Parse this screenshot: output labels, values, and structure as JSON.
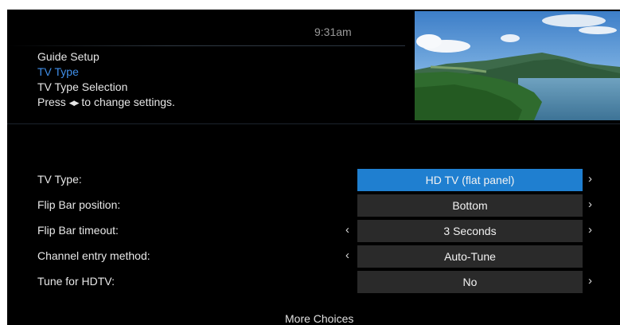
{
  "status": {
    "time": "9:31am"
  },
  "breadcrumb": {
    "items": [
      "Guide Setup",
      "TV Type",
      "TV Type Selection"
    ],
    "active_index": 1,
    "hint_prefix": "Press",
    "hint_arrows": "◀▶",
    "hint_suffix": "to change settings."
  },
  "preview": {
    "icon": "live-tv-preview-landscape"
  },
  "settings": [
    {
      "label": "TV Type:",
      "value": "HD TV (flat panel)",
      "left_arrow": false,
      "right_arrow": true,
      "selected": true
    },
    {
      "label": "Flip Bar position:",
      "value": "Bottom",
      "left_arrow": false,
      "right_arrow": true,
      "selected": false
    },
    {
      "label": "Flip Bar timeout:",
      "value": "3 Seconds",
      "left_arrow": true,
      "right_arrow": true,
      "selected": false
    },
    {
      "label": "Channel entry method:",
      "value": "Auto-Tune",
      "left_arrow": true,
      "right_arrow": false,
      "selected": false
    },
    {
      "label": "Tune for HDTV:",
      "value": "No",
      "left_arrow": false,
      "right_arrow": true,
      "selected": false
    }
  ],
  "arrows": {
    "left": "‹",
    "right": "›"
  },
  "more_choices": "More Choices",
  "colors": {
    "background": "#000000",
    "accent": "#1f7fd0",
    "breadcrumb_active": "#3f8ee8",
    "value_box": "#2a2a2a"
  }
}
